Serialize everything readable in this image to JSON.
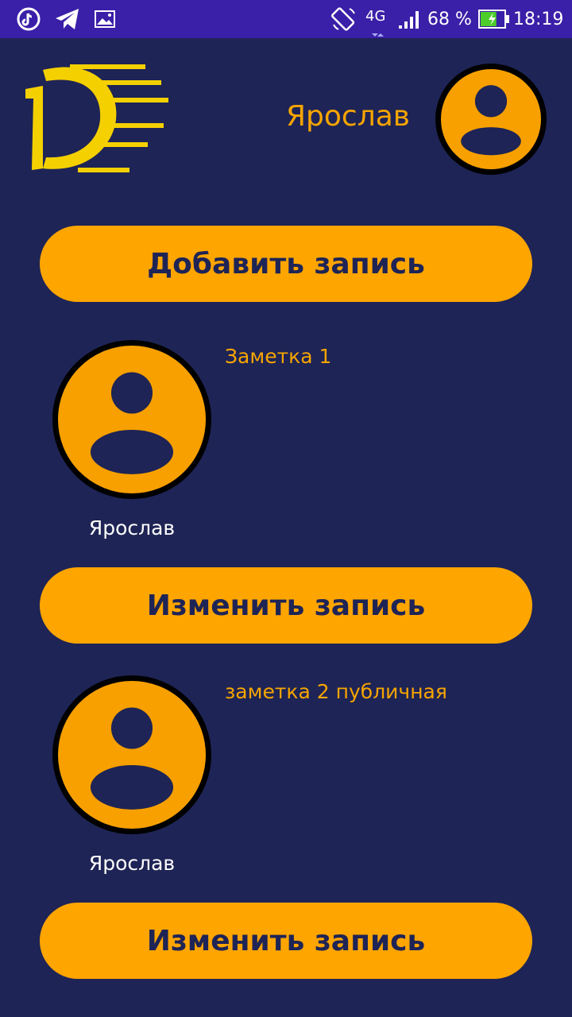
{
  "status_bar": {
    "icons": [
      "tiktok-icon",
      "telegram-icon",
      "gallery-icon",
      "rotate-icon",
      "signal-icon",
      "battery-icon"
    ],
    "network": "4G",
    "battery": "68 %",
    "time": "18:19",
    "battery_level": 0.68
  },
  "header": {
    "logo_icon": "d-logo-icon",
    "user_name": "Ярослав"
  },
  "buttons": {
    "add_label": "Добавить запись"
  },
  "notes": [
    {
      "title": "Заметка 1",
      "author": "Ярослав",
      "edit_label": "Изменить запись"
    },
    {
      "title": "заметка 2 публичная",
      "author": "Ярослав",
      "edit_label": "Изменить запись"
    }
  ],
  "colors": {
    "background": "#1e2455",
    "status_bar": "#3a1fa8",
    "accent": "#ffa500",
    "logo": "#f5d000"
  }
}
